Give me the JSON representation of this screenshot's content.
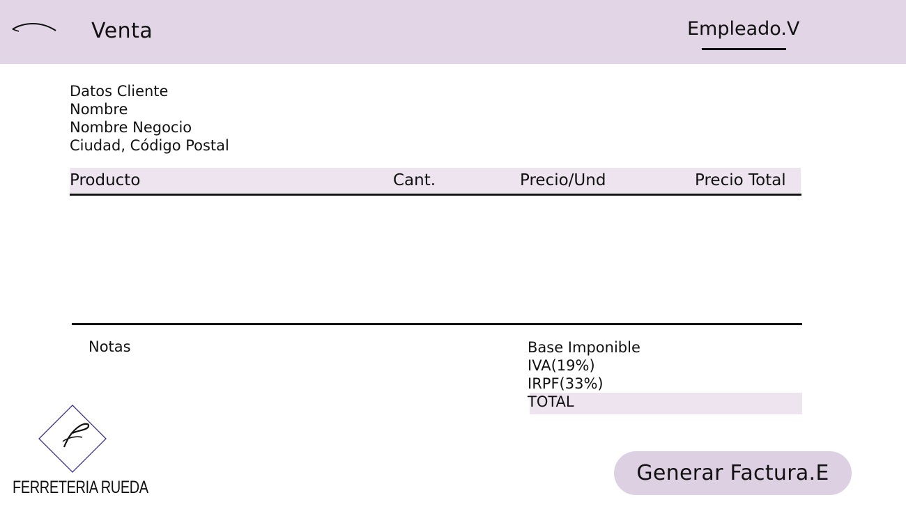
{
  "header": {
    "back_icon": "curved-arrow-left-icon",
    "title": "Venta",
    "employee": "Empleado.V"
  },
  "client": {
    "heading": "Datos Cliente",
    "name": "Nombre",
    "business_name": "Nombre Negocio",
    "location": "Ciudad, Código Postal"
  },
  "table": {
    "columns": [
      "Producto",
      "Cant.",
      "Precio/Und",
      "Precio Total"
    ],
    "rows": []
  },
  "notes": {
    "label": "Notas"
  },
  "totals": {
    "base": "Base Imponible",
    "iva": "IVA(19%)",
    "irpf": "IRPF(33%)",
    "total": "TOTAL"
  },
  "brand": {
    "logo_icon": "diamond-f-logo-icon",
    "name": "FERRETERIA RUEDA"
  },
  "actions": {
    "generate": "Generar Factura.E"
  },
  "colors": {
    "header_bg": "#e2d5e6",
    "band_bg": "#ede4f0",
    "button_bg": "#ddd0e2",
    "logo_accent": "#3b2f8a"
  }
}
